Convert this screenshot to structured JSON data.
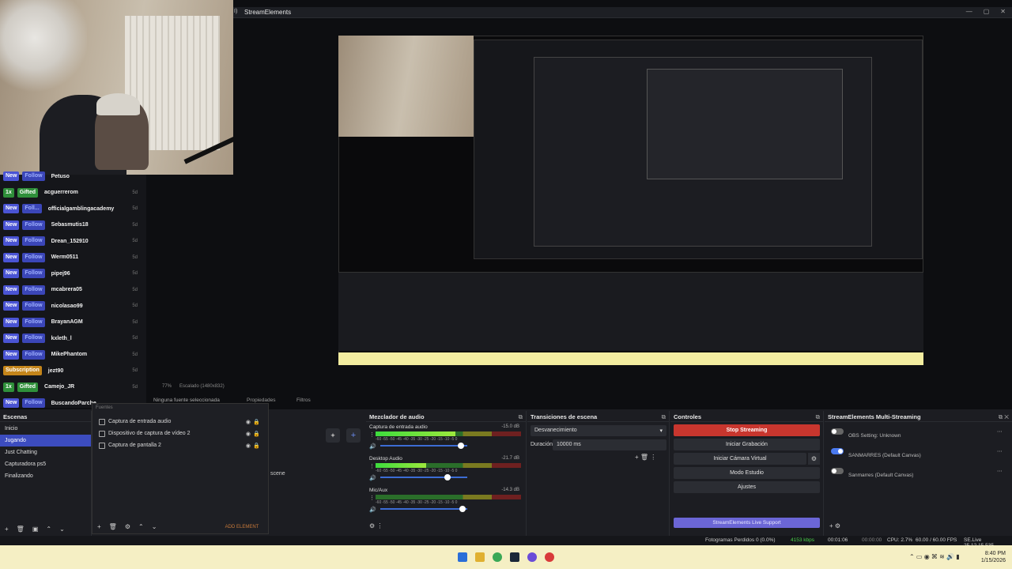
{
  "window": {
    "title": "StreamElements",
    "controls": [
      "—",
      "▢",
      "✕"
    ],
    "left_fragment": "I)"
  },
  "alert_feed": [
    {
      "badge": "New",
      "type": "Follow",
      "name": "Petuso",
      "ago": ""
    },
    {
      "badge": "1x",
      "type": "Gifted",
      "name": "acguerrerom",
      "ago": "5d"
    },
    {
      "badge": "New",
      "type": "Foll...",
      "name": "officialgamblingacademy",
      "ago": "5d"
    },
    {
      "badge": "New",
      "type": "Follow",
      "name": "Sebasmutis18",
      "ago": "5d"
    },
    {
      "badge": "New",
      "type": "Follow",
      "name": "Drean_152910",
      "ago": "5d"
    },
    {
      "badge": "New",
      "type": "Follow",
      "name": "Werm0511",
      "ago": "5d"
    },
    {
      "badge": "New",
      "type": "Follow",
      "name": "pipej96",
      "ago": "5d"
    },
    {
      "badge": "New",
      "type": "Follow",
      "name": "mcabrera05",
      "ago": "5d"
    },
    {
      "badge": "New",
      "type": "Follow",
      "name": "nicolasao99",
      "ago": "5d"
    },
    {
      "badge": "New",
      "type": "Follow",
      "name": "BrayanAGM",
      "ago": "5d"
    },
    {
      "badge": "New",
      "type": "Follow",
      "name": "kxleth_l",
      "ago": "5d"
    },
    {
      "badge": "New",
      "type": "Follow",
      "name": "MikePhantom",
      "ago": "5d"
    },
    {
      "badge": "",
      "type": "Subscription",
      "name": "jezt90",
      "ago": "5d"
    },
    {
      "badge": "1x",
      "type": "Gifted",
      "name": "Camejo_JR",
      "ago": "5d"
    },
    {
      "badge": "New",
      "type": "Follow",
      "name": "BuscandoParche",
      "ago": ""
    }
  ],
  "subbar": {
    "zoom": "77%",
    "scale": "Escalado (1480x832)",
    "no_source": "Ninguna fuente seleccionada",
    "properties": "Propiedades",
    "filters": "Filtros"
  },
  "scenes": {
    "title": "Escenas",
    "items": [
      "Inicio",
      "Jugando",
      "Just Chatting",
      "Capturadora ps5",
      "Finalizando"
    ],
    "selected": 1
  },
  "sources": {
    "hint": "Fuentes",
    "items": [
      "Captura de entrada audio",
      "Dispositivo de captura de vídeo 2",
      "Captura de pantalla 2"
    ],
    "add_element": "ADD ELEMENT",
    "behind_text": "scene"
  },
  "mixer": {
    "title": "Mezclador de audio",
    "tracks": [
      {
        "name": "Captura de entrada audio",
        "db": "-15.0 dB",
        "level": 0.55
      },
      {
        "name": "Desktop Audio",
        "db": "-21.7 dB",
        "level": 0.35
      },
      {
        "name": "Mic/Aux",
        "db": "-14.3 dB",
        "level": 0.0
      }
    ],
    "scale": "-60 -55 -50 -45 -40 -35 -30 -25 -20 -15 -10 -5 0"
  },
  "transitions": {
    "title": "Transiciones de escena",
    "type": "Desvanecimiento",
    "duration_label": "Duración",
    "duration": "10000 ms"
  },
  "controls": {
    "title": "Controles",
    "stop_streaming": "Stop Streaming",
    "start_recording": "Iniciar Grabación",
    "virtual_cam": "Iniciar Cámara Virtual",
    "studio_mode": "Modo Estudio",
    "settings": "Ajustes",
    "support": "StreamElements Live Support"
  },
  "multistream": {
    "title": "StreamElements Multi-Streaming",
    "items": [
      {
        "name": "OBS Setting: Unknown",
        "enabled": false
      },
      {
        "name": "SANMARRES (Default Canvas)",
        "enabled": true
      },
      {
        "name": "Sanmarres (Default Canvas)",
        "enabled": false
      }
    ]
  },
  "status": {
    "dropped": "Fotogramas Perdidos 0 (0.0%)",
    "kbps": "4153 kbps",
    "live_time": "00:01:06",
    "rec_time": "00:00:00",
    "cpu": "CPU: 2.7%",
    "fps": "60.00 / 60.00 FPS",
    "version": "SE.Live 25.12.15.535"
  },
  "taskbar": {
    "time": "8:40 PM",
    "date": "1/15/2026"
  },
  "colors": {
    "accent": "#3c4cbf",
    "stream_red": "#c8362e",
    "support_purple": "#6b66d6",
    "taskbar": "#f5efc4"
  }
}
